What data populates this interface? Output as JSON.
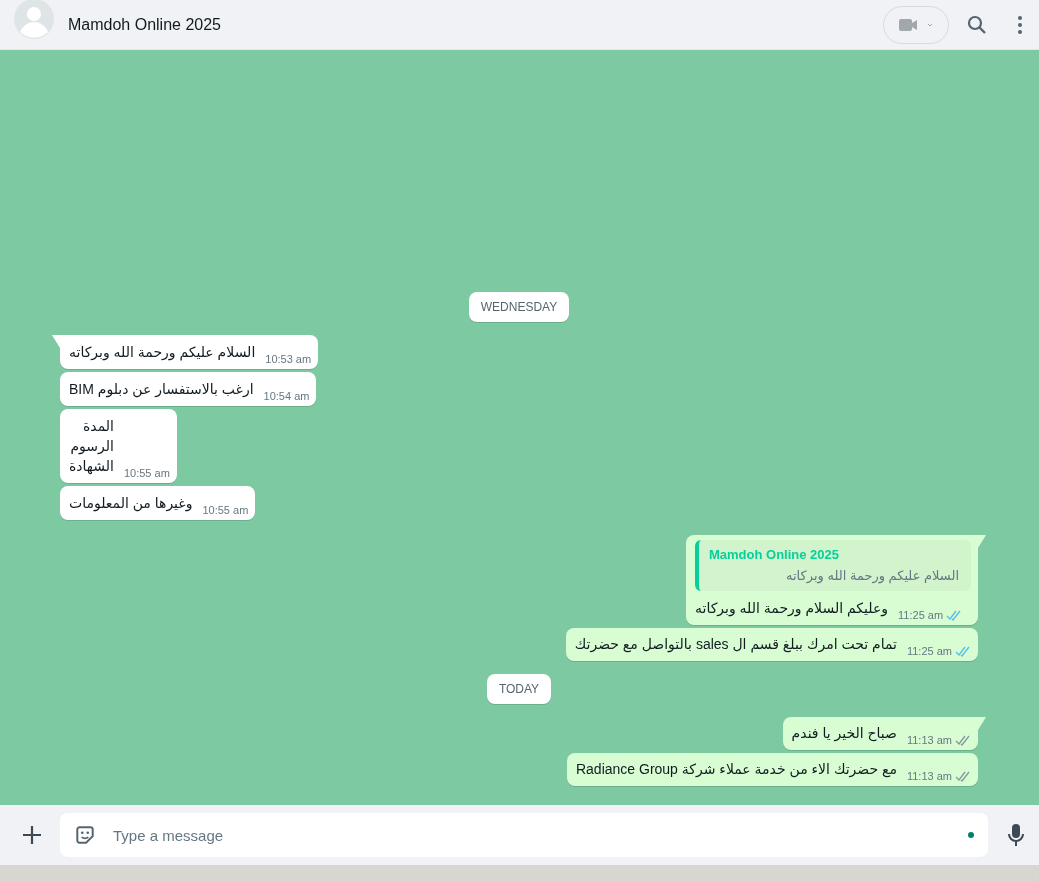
{
  "header": {
    "title": "Mamdoh Online 2025"
  },
  "chat": [
    {
      "kind": "date",
      "text": "WEDNESDAY"
    },
    {
      "kind": "incoming",
      "tail": true,
      "text": "السلام عليكم ورحمة الله وبركاته",
      "time": "10:53 am"
    },
    {
      "kind": "incoming",
      "tail": false,
      "text": "ارغب بالاستفسار عن دبلوم BIM",
      "time": "10:54 am"
    },
    {
      "kind": "incoming",
      "tail": false,
      "text": "المدة\nالرسوم\nالشهادة",
      "time": "10:55 am"
    },
    {
      "kind": "incoming",
      "tail": false,
      "text": "وغيرها من المعلومات",
      "time": "10:55 am"
    },
    {
      "kind": "outgoing",
      "tail": true,
      "quote": {
        "author": "Mamdoh Online 2025",
        "text": "السلام عليكم ورحمة الله وبركاته"
      },
      "text": "وعليكم السلام ورحمة الله وبركاته",
      "time": "11:25 am",
      "read": true
    },
    {
      "kind": "outgoing",
      "tail": false,
      "text": "تمام تحت امرك ببلغ قسم ال sales بالتواصل مع حضرتك",
      "time": "11:25 am",
      "read": true
    },
    {
      "kind": "date",
      "text": "TODAY"
    },
    {
      "kind": "outgoing",
      "tail": true,
      "text": "صباح الخير يا فندم",
      "time": "11:13 am",
      "read": false
    },
    {
      "kind": "outgoing",
      "tail": false,
      "text": "مع حضرتك الاء من خدمة عملاء شركة Radiance Group",
      "time": "11:13 am",
      "read": false
    }
  ],
  "composer": {
    "placeholder": "Type a message"
  }
}
